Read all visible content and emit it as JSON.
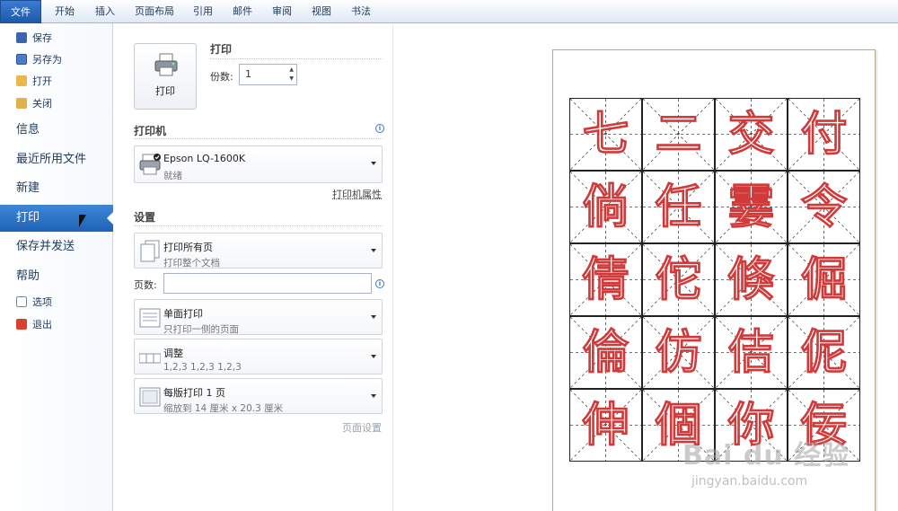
{
  "ribbon": {
    "tabs": [
      "文件",
      "开始",
      "插入",
      "页面布局",
      "引用",
      "邮件",
      "审阅",
      "视图",
      "书法"
    ]
  },
  "nav": {
    "small_top": [
      "保存",
      "另存为",
      "打开",
      "关闭"
    ],
    "large": [
      "信息",
      "最近所用文件",
      "新建",
      "打印",
      "保存并发送",
      "帮助"
    ],
    "active": "打印",
    "small_bottom": [
      "选项",
      "退出"
    ]
  },
  "print": {
    "button_label": "打印",
    "section_title": "打印",
    "copies_label": "份数:",
    "copies_value": "1"
  },
  "printer": {
    "section_title": "打印机",
    "name": "Epson LQ-1600K",
    "status": "就绪",
    "properties_link": "打印机属性"
  },
  "settings": {
    "section_title": "设置",
    "pages_label": "页数:",
    "pages_value": "",
    "dropdowns": [
      {
        "title": "打印所有页",
        "subtitle": "打印整个文档"
      },
      {
        "title": "单面打印",
        "subtitle": "只打印一侧的页面"
      },
      {
        "title": "调整",
        "subtitle": "1,2,3     1,2,3     1,2,3"
      },
      {
        "title": "每版打印 1 页",
        "subtitle": "缩放到 14 厘米 x 20.3 厘米"
      }
    ],
    "page_setup_link": "页面设置"
  },
  "preview": {
    "characters": [
      [
        "七",
        "二",
        "交",
        "付"
      ],
      [
        "倘",
        "任",
        "霎",
        "令"
      ],
      [
        "倩",
        "佗",
        "倏",
        "倔"
      ],
      [
        "倫",
        "仿",
        "佶",
        "伲"
      ],
      [
        "伸",
        "個",
        "你",
        "佞"
      ]
    ],
    "watermark": "Bai du 经验",
    "watermark_url": "jingyan.baidu.com"
  },
  "colors": {
    "accent": "#2a6fc4",
    "character_outline": "#d23a3a"
  }
}
